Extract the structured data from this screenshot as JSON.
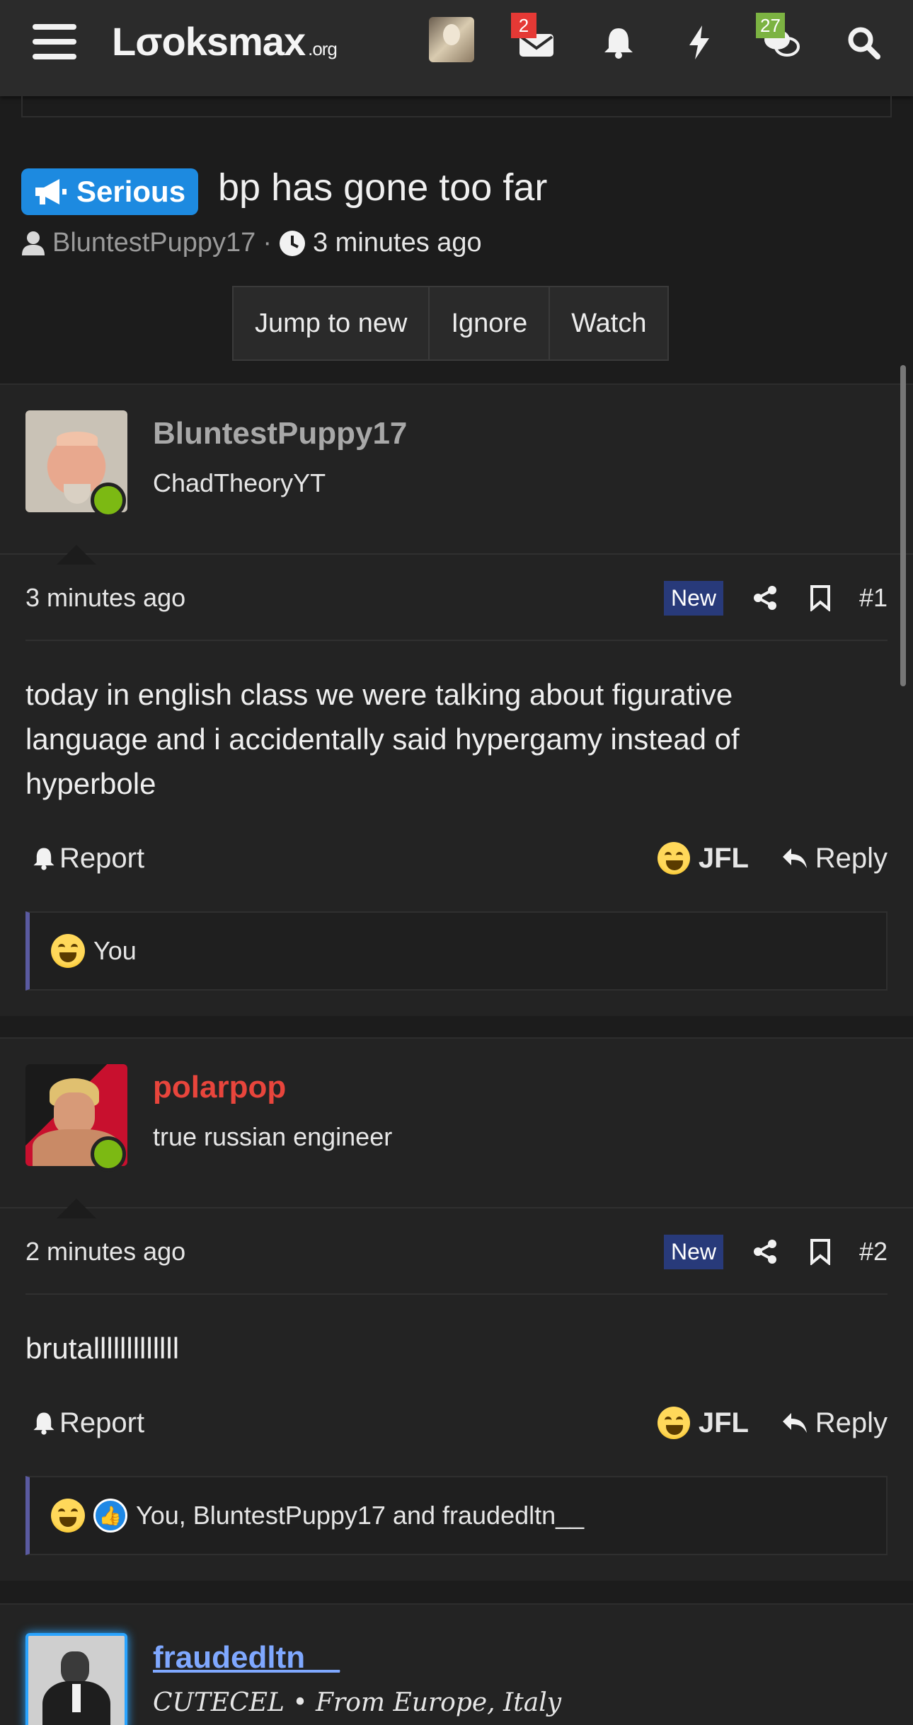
{
  "header": {
    "logo": "Lσoksmax",
    "logo_suffix": ".org",
    "inbox_count": "2",
    "chat_count": "27"
  },
  "thread": {
    "prefix": "Serious",
    "title": "bp has gone too far",
    "author": "BluntestPuppy17",
    "time": "3 minutes ago",
    "buttons": [
      "Jump to new",
      "Ignore",
      "Watch"
    ]
  },
  "posts": [
    {
      "username": "BluntestPuppy17",
      "user_title": "ChadTheoryYT",
      "time": "3 minutes ago",
      "new_label": "New",
      "number": "#1",
      "body": "today in english class we were talking about figurative language and i accidentally said hypergamy instead of hyperbole",
      "report": "Report",
      "reaction_label": "JFL",
      "reply": "Reply",
      "reacted_by": "You"
    },
    {
      "username": "polarpop",
      "user_title": "true russian engineer",
      "time": "2 minutes ago",
      "new_label": "New",
      "number": "#2",
      "body": "brutalllllllllllll",
      "report": "Report",
      "reaction_label": "JFL",
      "reply": "Reply",
      "reacted_by": "You, BluntestPuppy17 and fraudedltn__"
    },
    {
      "username": "fraudedltn__",
      "user_title": "CUTECEL • From Europe, Italy"
    }
  ],
  "colors": {
    "accent_blue": "#1d8ae0",
    "online": "#7cb913",
    "username_red": "#e8453c",
    "username_gray": "#a8a8a8",
    "username_blue": "#7fa8ff"
  }
}
